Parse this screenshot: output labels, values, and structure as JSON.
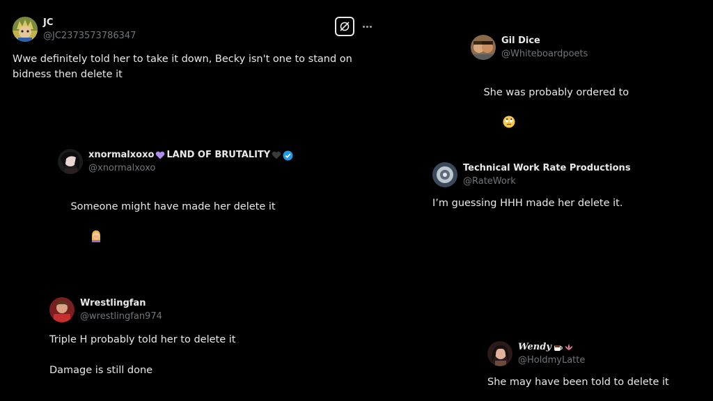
{
  "tweets": [
    {
      "name": "JC",
      "handle": "@JC2373573786347",
      "text": "Wwe definitely told her to take it down, Becky isn't one to stand on\nbidness then delete it",
      "avatar_icon": "cartoon-character-avatar"
    },
    {
      "name": "Gil Dice",
      "handle": "@Whiteboardpoets",
      "text": "She was probably ordered to",
      "emoji": "face-with-rolling-eyes"
    },
    {
      "name": "xnormalxoxo",
      "name_suffix": "LAND OF BRUTALITY",
      "handle": "@xnormalxoxo",
      "text": "Someone might have made her delete it",
      "emoji": "person-facepalming",
      "verified_color": "#1d9bf0"
    },
    {
      "name": "Technical Work Rate Productions",
      "handle": "@RateWork",
      "text": "I’m guessing HHH made her delete it."
    },
    {
      "name": "Wrestlingfan",
      "handle": "@wrestlingfan974",
      "text": "Triple H probably told her to delete it\n\nDamage is still done"
    },
    {
      "name": "Wendy",
      "handle": "@HoldmyLatte",
      "text": "She may have been told to delete it",
      "name_icons": [
        "coffee-cup-icon",
        "lotus-icon"
      ]
    }
  ],
  "colors": {
    "background": "#000000",
    "text": "#e7e9ea",
    "secondary": "#71767b",
    "verified": "#1d9bf0",
    "purple_heart": "#b18cf0"
  }
}
